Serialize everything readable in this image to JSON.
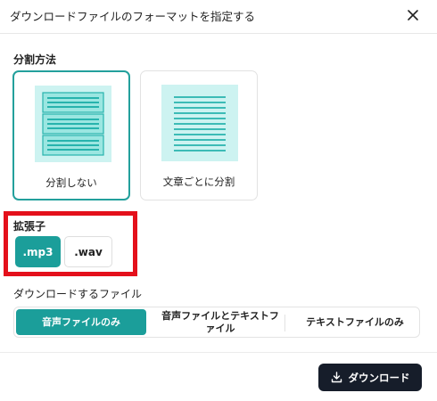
{
  "dialog": {
    "title": "ダウンロードファイルのフォーマットを指定する",
    "close_icon": "close-icon"
  },
  "split": {
    "label": "分割方法",
    "options": [
      {
        "label": "分割しない",
        "selected": true
      },
      {
        "label": "文章ごとに分割",
        "selected": false
      }
    ]
  },
  "extension": {
    "label": "拡張子",
    "options": [
      {
        "label": ".mp3",
        "selected": true
      },
      {
        "label": ".wav",
        "selected": false
      }
    ],
    "highlight_color": "#e4101b"
  },
  "file_type": {
    "label": "ダウンロードするファイル",
    "options": [
      {
        "label": "音声ファイルのみ",
        "selected": true
      },
      {
        "label": "音声ファイルとテキストファイル",
        "selected": false
      },
      {
        "label": "テキストファイルのみ",
        "selected": false
      }
    ]
  },
  "footer": {
    "download_label": "ダウンロード",
    "download_icon": "download-icon"
  },
  "colors": {
    "accent": "#1b9e9a",
    "illustration_bg": "#cdf3f1",
    "button_dark": "#161d2a"
  }
}
